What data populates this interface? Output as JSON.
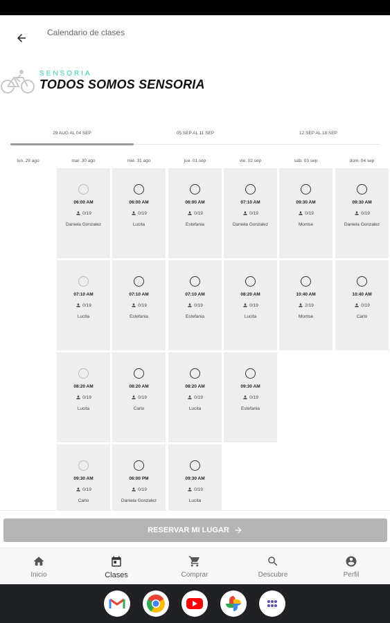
{
  "header": {
    "title": "Calendario de clases"
  },
  "brand": {
    "small": "SENSORIA",
    "big": "TODOS SOMOS SENSORIA"
  },
  "weeks": [
    {
      "label": "29 AUG AL 04 SEP",
      "active": true
    },
    {
      "label": "05 SEP AL 11 SEP",
      "active": false
    },
    {
      "label": "12 SEP AL 18 SEP",
      "active": false
    }
  ],
  "days": [
    "lun. 29 ago",
    "mar. 30 ago",
    "mié. 31 ago",
    "jue. 01 sep",
    "vie. 02 sep",
    "sáb. 03 sep",
    "dom. 04 sep"
  ],
  "classes": [
    {
      "day": 1,
      "row": 0,
      "time": "06:00 AM",
      "capacity": "0/19",
      "instructor": "Daniela Gonzalez",
      "faded": true
    },
    {
      "day": 1,
      "row": 1,
      "time": "07:10 AM",
      "capacity": "0/19",
      "instructor": "Lucita",
      "faded": true
    },
    {
      "day": 1,
      "row": 2,
      "time": "08:20 AM",
      "capacity": "0/19",
      "instructor": "Lucita",
      "faded": true
    },
    {
      "day": 1,
      "row": 3,
      "time": "09:30 AM",
      "capacity": "0/19",
      "instructor": "Carlo",
      "faded": true
    },
    {
      "day": 2,
      "row": 0,
      "time": "06:00 AM",
      "capacity": "0/19",
      "instructor": "Lucita",
      "faded": false
    },
    {
      "day": 2,
      "row": 1,
      "time": "07:10 AM",
      "capacity": "0/19",
      "instructor": "Estefania",
      "faded": false
    },
    {
      "day": 2,
      "row": 2,
      "time": "08:20 AM",
      "capacity": "0/19",
      "instructor": "Carlo",
      "faded": false
    },
    {
      "day": 2,
      "row": 3,
      "time": "06:00 PM",
      "capacity": "0/19",
      "instructor": "Daniela Gonzalez",
      "faded": false
    },
    {
      "day": 3,
      "row": 0,
      "time": "06:00 AM",
      "capacity": "0/19",
      "instructor": "Estefania",
      "faded": false
    },
    {
      "day": 3,
      "row": 1,
      "time": "07:10 AM",
      "capacity": "0/19",
      "instructor": "Estefania",
      "faded": false
    },
    {
      "day": 3,
      "row": 2,
      "time": "08:20 AM",
      "capacity": "0/19",
      "instructor": "Lucita",
      "faded": false
    },
    {
      "day": 3,
      "row": 3,
      "time": "09:30 AM",
      "capacity": "0/19",
      "instructor": "Lucita",
      "faded": false
    },
    {
      "day": 4,
      "row": 0,
      "time": "07:10 AM",
      "capacity": "0/19",
      "instructor": "Daniela Gonzalez",
      "faded": false
    },
    {
      "day": 4,
      "row": 1,
      "time": "08:20 AM",
      "capacity": "0/19",
      "instructor": "Lucita",
      "faded": false
    },
    {
      "day": 4,
      "row": 2,
      "time": "09:30 AM",
      "capacity": "0/19",
      "instructor": "Estefania",
      "faded": false
    },
    {
      "day": 5,
      "row": 0,
      "time": "09:30 AM",
      "capacity": "0/19",
      "instructor": "Montse",
      "faded": false
    },
    {
      "day": 5,
      "row": 1,
      "time": "10:40 AM",
      "capacity": "2/19",
      "instructor": "Montse",
      "faded": false
    },
    {
      "day": 6,
      "row": 0,
      "time": "09:30 AM",
      "capacity": "0/19",
      "instructor": "Daniela Gonzalez",
      "faded": false
    },
    {
      "day": 6,
      "row": 1,
      "time": "10:40 AM",
      "capacity": "0/19",
      "instructor": "Carlo",
      "faded": false
    }
  ],
  "reserve": {
    "label": "RESERVAR MI LUGAR",
    "icon": "arrow-right-icon"
  },
  "nav": [
    {
      "label": "Inicio",
      "icon": "home-icon",
      "active": false
    },
    {
      "label": "Clases",
      "icon": "calendar-icon",
      "active": true
    },
    {
      "label": "Comprar",
      "icon": "cart-icon",
      "active": false
    },
    {
      "label": "Descubre",
      "icon": "search-icon",
      "active": false
    },
    {
      "label": "Perfil",
      "icon": "account-icon",
      "active": false
    }
  ],
  "dock": [
    "gmail-icon",
    "chrome-icon",
    "youtube-icon",
    "photos-icon",
    "app-drawer-icon"
  ],
  "colors": {
    "brand_accent": "#2fd4b0",
    "reserve_disabled": "#b4b4b4",
    "cell_bg": "#eeeeee"
  }
}
